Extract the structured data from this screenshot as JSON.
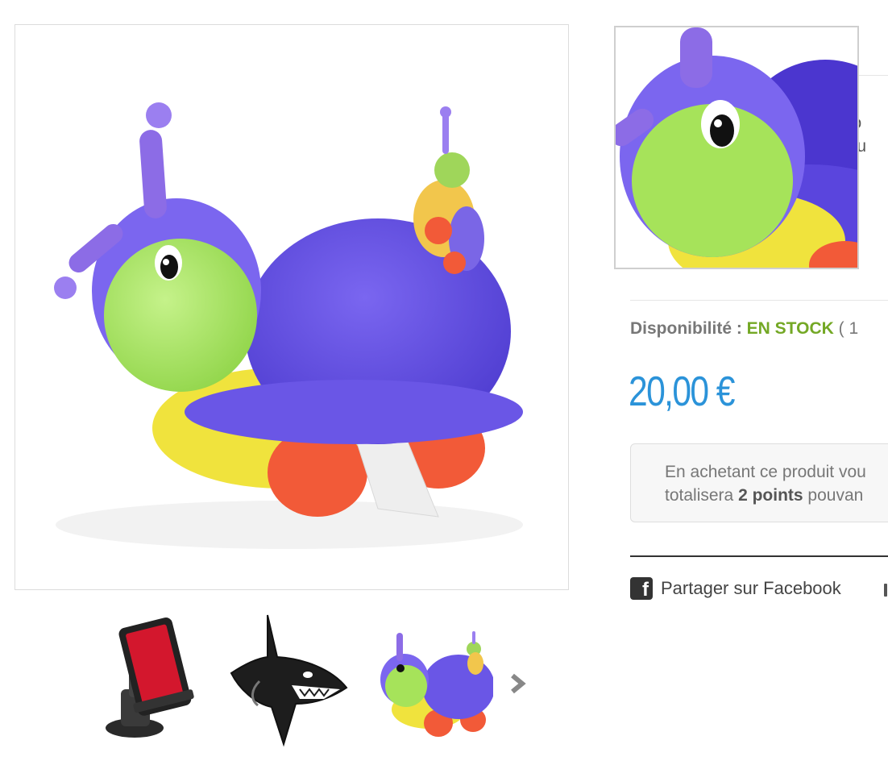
{
  "product": {
    "main_image_icon": "snail-plush-image",
    "zoom_icon": "snail-plush-zoom",
    "background_description_lines": [
      "n o",
      "ndu"
    ]
  },
  "thumbnails": [
    {
      "icon": "phone-holder-image"
    },
    {
      "icon": "shark-image"
    },
    {
      "icon": "snail-plush-thumbnail"
    }
  ],
  "thumbnails_next_icon": "chevron-right-icon",
  "availability": {
    "label": "Disponibilité :",
    "value": "EN STOCK",
    "count": "( 1"
  },
  "price": "20,00 €",
  "loyalty": {
    "line1": "En achetant ce produit vou",
    "line2_prefix": "totalisera",
    "points": "2 points",
    "line2_suffix": "pouvan"
  },
  "share": {
    "facebook_label": "Partager sur Facebook",
    "facebook_icon": "facebook-icon"
  },
  "colors": {
    "price": "#2b93d9",
    "in_stock": "#74a825",
    "plush_purple": "#6b55e0",
    "plush_green": "#a6e35a",
    "plush_yellow": "#f2e646",
    "plush_orange": "#f5603f"
  }
}
